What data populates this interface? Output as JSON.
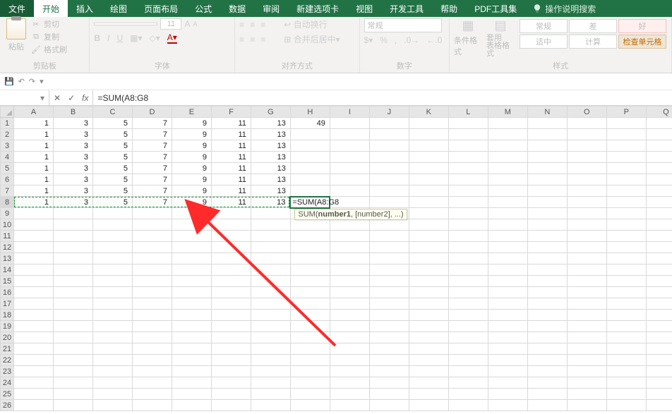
{
  "tabs": {
    "file": "文件",
    "items": [
      "开始",
      "插入",
      "绘图",
      "页面布局",
      "公式",
      "数据",
      "审阅",
      "新建选项卡",
      "视图",
      "开发工具",
      "帮助",
      "PDF工具集"
    ],
    "active": "开始",
    "tell_me": "操作说明搜索"
  },
  "ribbon": {
    "clipboard": {
      "paste": "粘贴",
      "cut": "剪切",
      "copy": "复制",
      "format_painter": "格式刷",
      "label": "剪贴板"
    },
    "font": {
      "font_name": "",
      "font_size": "11",
      "bold": "B",
      "italic": "I",
      "underline": "U",
      "label": "字体",
      "increase": "A",
      "decrease": "A"
    },
    "alignment": {
      "wrap": "自动换行",
      "merge": "合并后居中",
      "label": "对齐方式"
    },
    "number": {
      "format": "常规",
      "label": "数字"
    },
    "styles": {
      "cond": "条件格式",
      "table": "套用\n表格格式",
      "cells": {
        "normal": "常规",
        "bad": "差",
        "good": "好",
        "neutral": "适中",
        "calc": "计算",
        "check": "检查单元格"
      },
      "label": "样式"
    }
  },
  "qat": {
    "save": "💾",
    "undo": "↶",
    "redo": "↷",
    "dd": "▾"
  },
  "formula_bar": {
    "name": "",
    "cancel": "✕",
    "enter": "✓",
    "fx": "fx",
    "formula": "=SUM(A8:G8"
  },
  "grid": {
    "columns": [
      "A",
      "B",
      "C",
      "D",
      "E",
      "F",
      "G",
      "H",
      "I",
      "J",
      "K",
      "L",
      "M",
      "N",
      "O",
      "P",
      "Q"
    ],
    "row_numbers": [
      "1",
      "2",
      "3",
      "4",
      "5",
      "6",
      "7",
      "8",
      "9",
      "10",
      "11",
      "12",
      "13",
      "14",
      "15",
      "16",
      "17",
      "18",
      "19",
      "20",
      "21",
      "22",
      "23",
      "24",
      "25",
      "26"
    ],
    "data": [
      [
        "1",
        "3",
        "5",
        "7",
        "9",
        "11",
        "13",
        "49"
      ],
      [
        "1",
        "3",
        "5",
        "7",
        "9",
        "11",
        "13",
        ""
      ],
      [
        "1",
        "3",
        "5",
        "7",
        "9",
        "11",
        "13",
        ""
      ],
      [
        "1",
        "3",
        "5",
        "7",
        "9",
        "11",
        "13",
        ""
      ],
      [
        "1",
        "3",
        "5",
        "7",
        "9",
        "11",
        "13",
        ""
      ],
      [
        "1",
        "3",
        "5",
        "7",
        "9",
        "11",
        "13",
        ""
      ],
      [
        "1",
        "3",
        "5",
        "7",
        "9",
        "11",
        "13",
        ""
      ],
      [
        "1",
        "3",
        "5",
        "7",
        "9",
        "11",
        "13",
        "=SUM(A8:G8"
      ]
    ],
    "tooltip_prefix": "SUM(",
    "tooltip_bold": "number1",
    "tooltip_suffix": ", [number2], ...)"
  }
}
